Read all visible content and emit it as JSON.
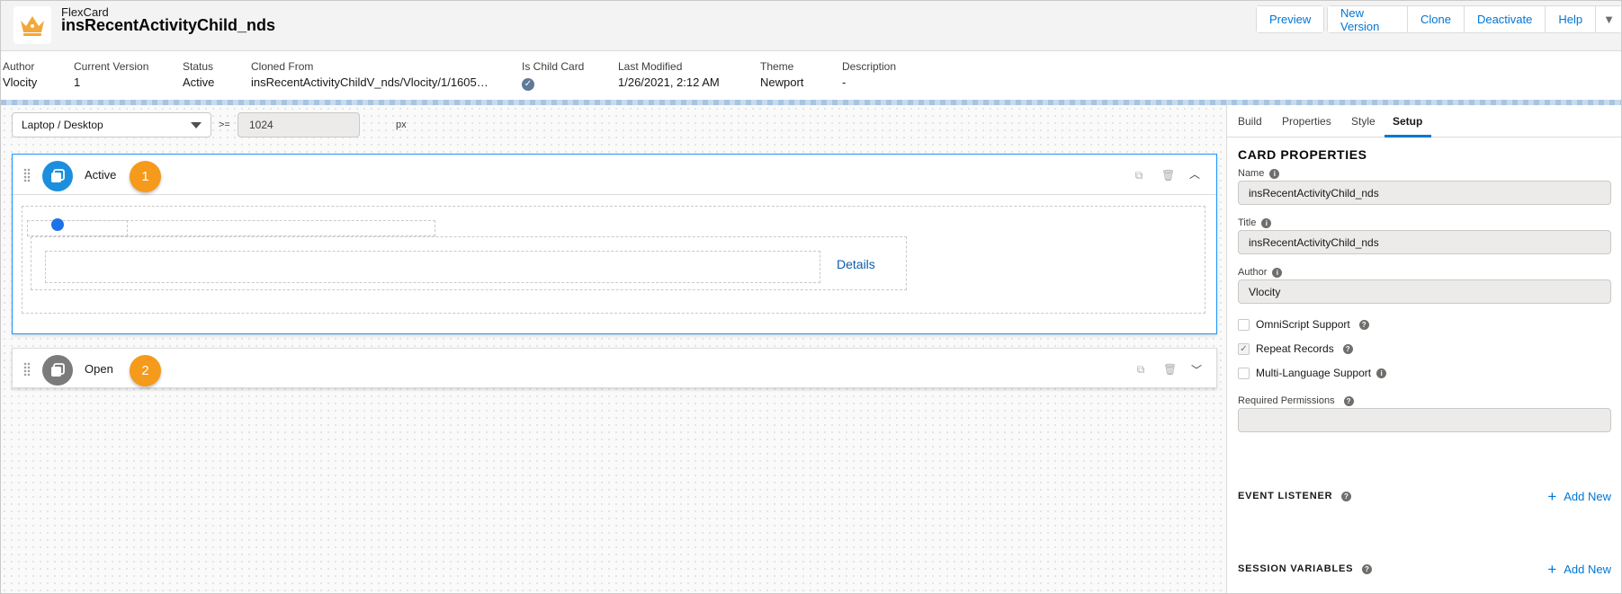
{
  "header": {
    "subtitle": "FlexCard",
    "title": "insRecentActivityChild_nds",
    "app_icon": "crown-icon",
    "buttons": [
      "Preview",
      "New Version",
      "Clone",
      "Deactivate",
      "Help"
    ]
  },
  "meta": {
    "author_label": "Author",
    "author": "Vlocity",
    "version_label": "Current Version",
    "version": "1",
    "status_label": "Status",
    "status": "Active",
    "cloned_label": "Cloned From",
    "cloned": "insRecentActivityChildV_nds/Vlocity/1/1605…",
    "child_label": "Is Child Card",
    "modified_label": "Last Modified",
    "modified": "1/26/2021, 2:12 AM",
    "theme_label": "Theme",
    "theme": "Newport",
    "description_label": "Description",
    "description": "-"
  },
  "toolbar": {
    "device": "Laptop / Desktop",
    "operator": ">=",
    "width": "1024",
    "unit": "px"
  },
  "states": [
    {
      "name": "Active",
      "badge": "1",
      "color": "#1b8fdd"
    },
    {
      "name": "Open",
      "badge": "2",
      "color": "#7b7b7b"
    }
  ],
  "canvas": {
    "details_link": "Details"
  },
  "panel": {
    "tabs": [
      "Build",
      "Properties",
      "Style",
      "Setup"
    ],
    "selected_tab": "Setup",
    "section_title": "CARD PROPERTIES",
    "name_label": "Name",
    "name_value": "insRecentActivityChild_nds",
    "title_label": "Title",
    "title_value": "insRecentActivityChild_nds",
    "author_label": "Author",
    "author_value": "Vlocity",
    "omniscript_label": "OmniScript Support",
    "repeat_label": "Repeat Records",
    "multilang_label": "Multi-Language Support",
    "permissions_label": "Required Permissions",
    "permissions_value": "",
    "event_listener_label": "EVENT LISTENER",
    "session_vars_label": "SESSION VARIABLES",
    "add_new_label": "Add New"
  },
  "colors": {
    "accent": "#0176d3",
    "badge": "#f59a1a",
    "brand_crown": "#f2a83a"
  }
}
